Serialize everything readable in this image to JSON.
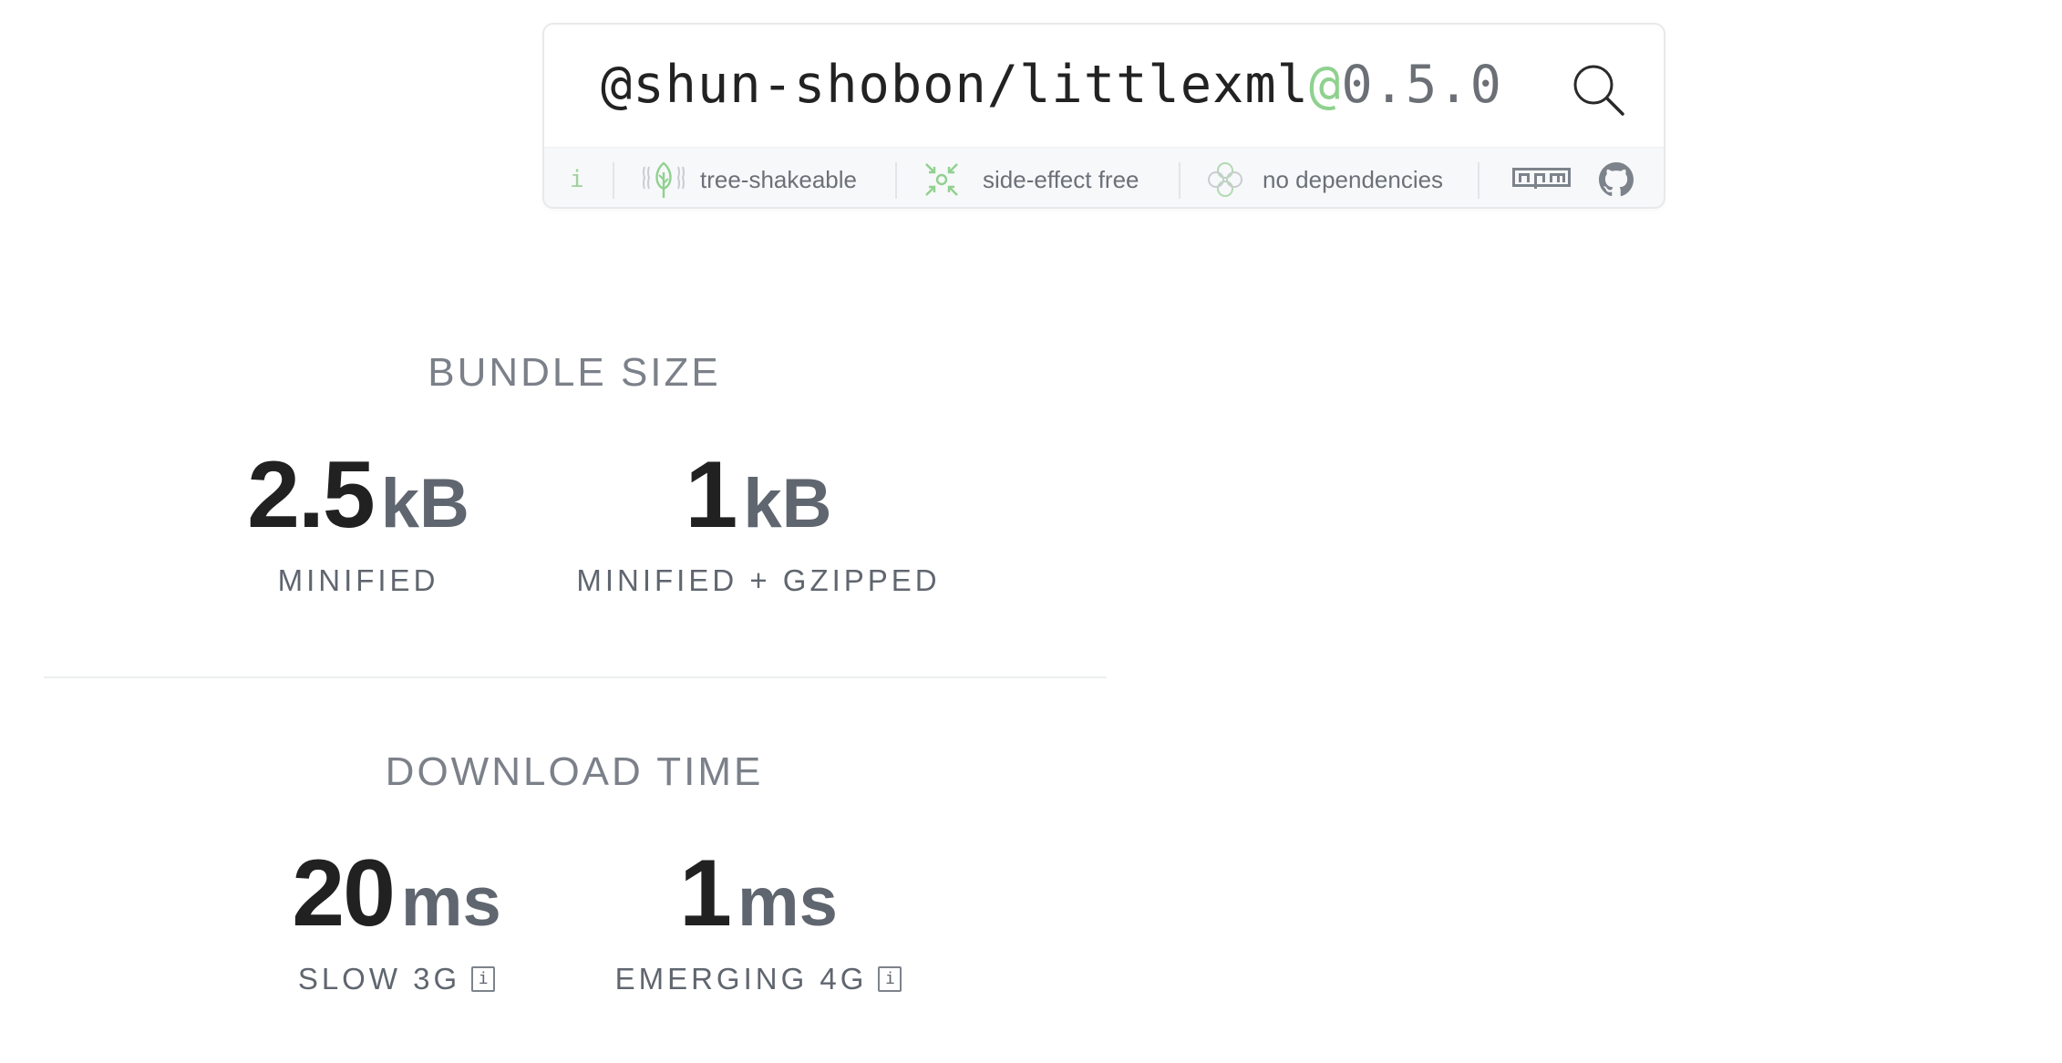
{
  "search": {
    "package_scope": "@shun-shobon/littlexml",
    "version_separator": "@",
    "version": "0.5.0",
    "search_icon": "magnifier-icon"
  },
  "badges": {
    "info_label": "i",
    "tree_shakeable": {
      "label": "tree-shakeable",
      "icon": "tree-icon"
    },
    "side_effect_free": {
      "label": "side-effect free",
      "icon": "compress-arrows-icon"
    },
    "no_dependencies": {
      "label": "no dependencies",
      "icon": "nodes-icon"
    },
    "npm": {
      "icon": "npm-logo-icon"
    },
    "github": {
      "icon": "github-logo-icon"
    }
  },
  "bundle_size": {
    "title": "BUNDLE SIZE",
    "minified": {
      "value": "2.5",
      "unit": "kB",
      "label": "MINIFIED"
    },
    "gzipped": {
      "value": "1",
      "unit": "kB",
      "label": "MINIFIED + GZIPPED"
    }
  },
  "download_time": {
    "title": "DOWNLOAD TIME",
    "slow_3g": {
      "value": "20",
      "unit": "ms",
      "label": "SLOW 3G",
      "info": "i"
    },
    "emerging_4g": {
      "value": "1",
      "unit": "ms",
      "label": "EMERGING 4G",
      "info": "i"
    }
  },
  "colors": {
    "accent_green": "#8fd18f",
    "text_dark": "#212121",
    "text_muted": "#60666f",
    "badge_bg": "#f7f8f9"
  }
}
